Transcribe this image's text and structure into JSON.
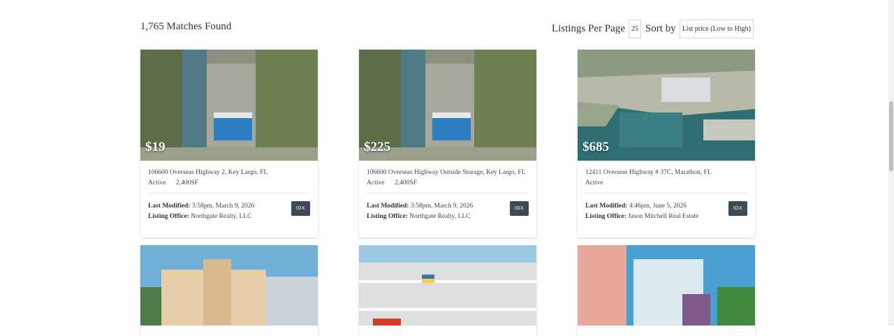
{
  "results": {
    "count_text": "1,765 Matches Found"
  },
  "toolbar": {
    "per_page_label": "Listings Per Page",
    "per_page_value": "25",
    "sort_label": "Sort by",
    "sort_value": "List price (Low to High)"
  },
  "listings": [
    {
      "price": "$19",
      "address": "106600 Overseas Highway 2, Key Largo, FL",
      "status": "Active",
      "size": "2,400SF",
      "modified_label": "Last Modified:",
      "modified_value": "3:58pm, March 9, 2026",
      "office_label": "Listing Office:",
      "office_value": "Northgate Realty, LLC",
      "badge": "IDX"
    },
    {
      "price": "$225",
      "address": "106600 Overseas Highway Outside Storage, Key Largo, FL",
      "status": "Active",
      "size": "2,400SF",
      "modified_label": "Last Modified:",
      "modified_value": "3:58pm, March 9, 2026",
      "office_label": "Listing Office:",
      "office_value": "Northgate Realty, LLC",
      "badge": "IDX"
    },
    {
      "price": "$685",
      "address": "12411 Overseas Highway # 37C, Marathon, FL",
      "status": "Active",
      "size": "",
      "modified_label": "Last Modified:",
      "modified_value": "4:46pm, June 5, 2026",
      "office_label": "Listing Office:",
      "office_value": "Jason Mitchell Real Estate",
      "badge": "IDX"
    }
  ],
  "colors": {
    "badge_bg": "#3f4a55",
    "water": "#2f6f73",
    "sky": "#6fb0d8"
  }
}
